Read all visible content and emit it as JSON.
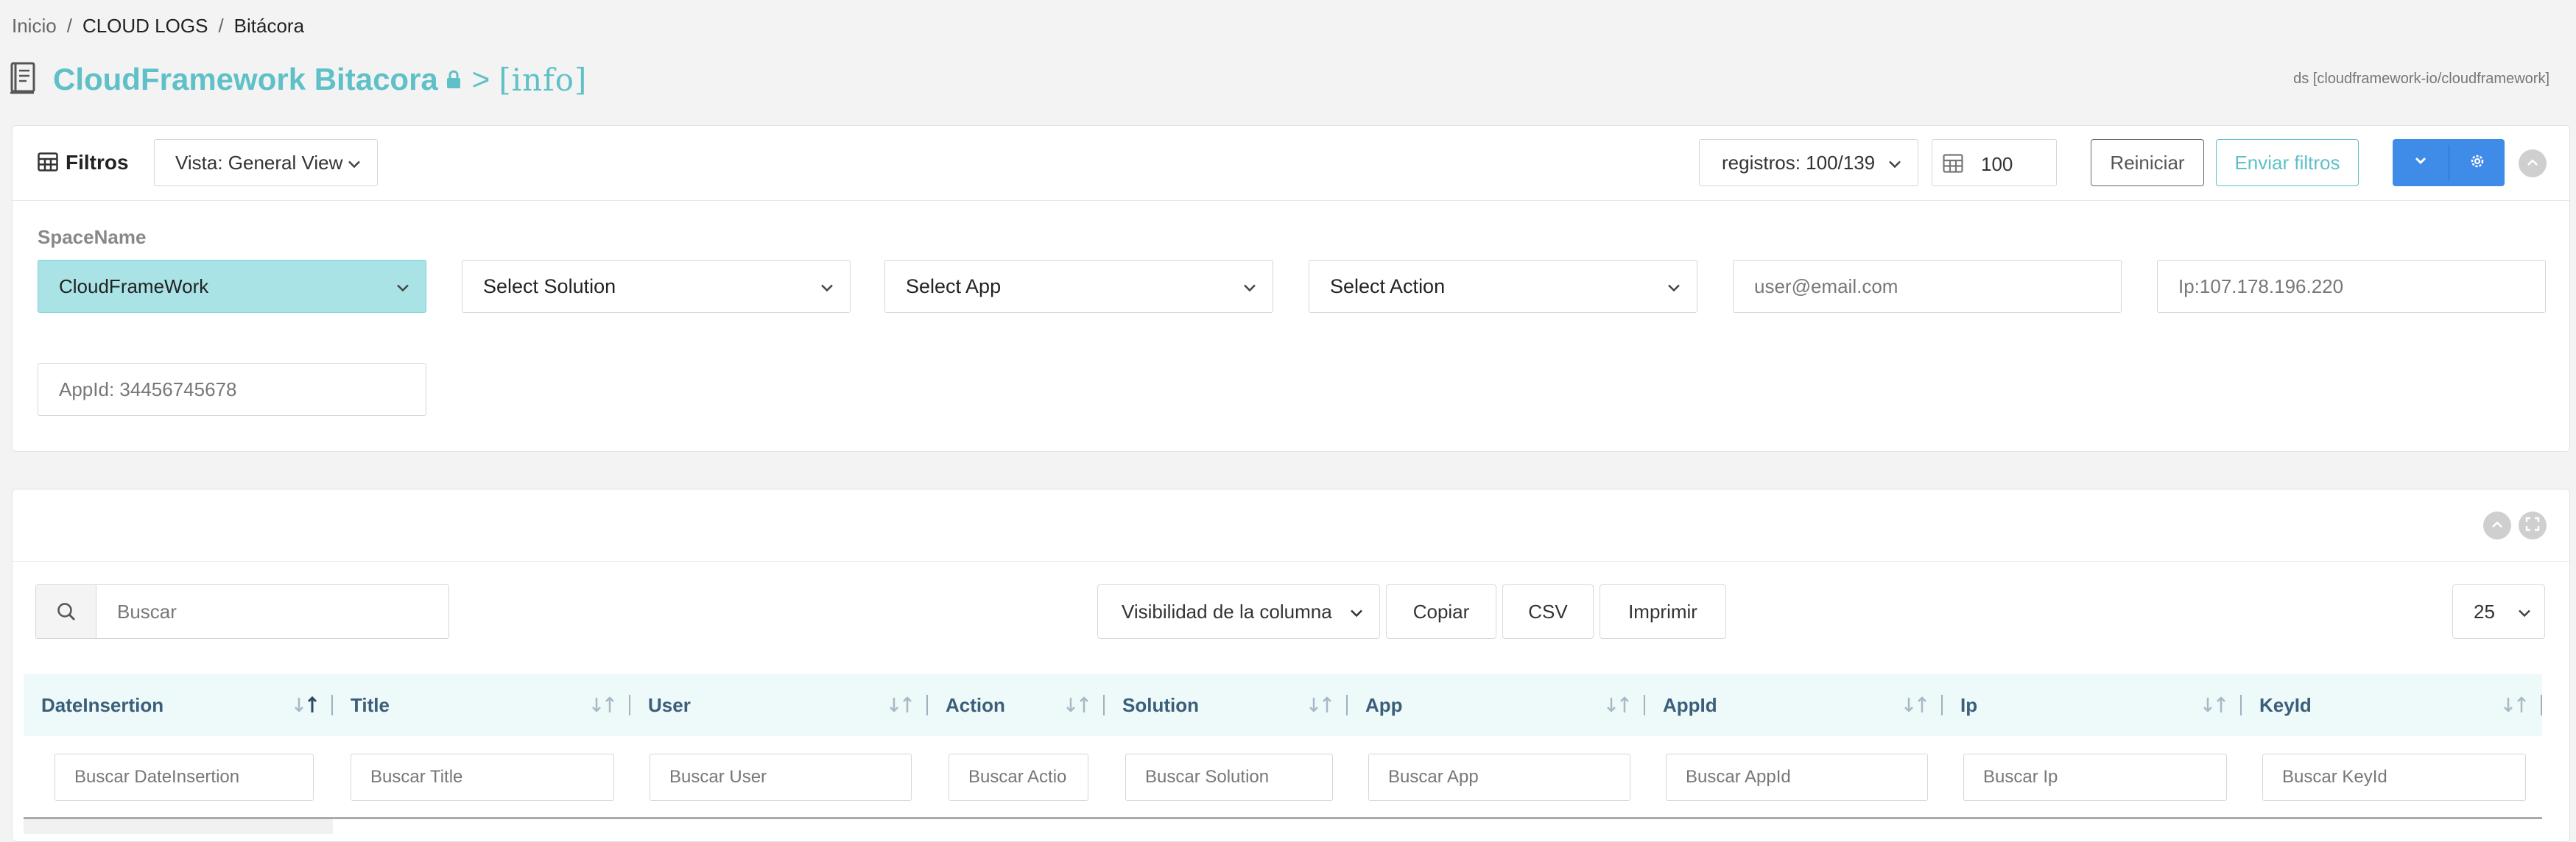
{
  "breadcrumb": {
    "items": [
      "Inicio",
      "CLOUD LOGS",
      "Bitácora"
    ]
  },
  "header": {
    "title": "CloudFramework Bitacora",
    "separator": ">",
    "info_label": "[info]",
    "datastore": "ds [cloudframework-io/cloudframework]"
  },
  "filters": {
    "title": "Filtros",
    "view_select": "Vista: General View",
    "records_select": "registros: 100/139",
    "limit_value": "100",
    "reset_button": "Reiniciar",
    "send_button": "Enviar filtros",
    "space_label": "SpaceName",
    "space_value": "CloudFrameWork",
    "solution_select": "Select Solution",
    "app_select": "Select App",
    "action_select": "Select Action",
    "email_placeholder": "user@email.com",
    "ip_placeholder": "Ip:107.178.196.220",
    "appid_placeholder": "AppId: 34456745678"
  },
  "table": {
    "search_placeholder": "Buscar",
    "toolbar": {
      "visibility": "Visibilidad de la columna",
      "copy": "Copiar",
      "csv": "CSV",
      "print": "Imprimir",
      "page_size": "25"
    },
    "columns": [
      {
        "label": "DateInsertion",
        "search_placeholder": "Buscar DateInsertion"
      },
      {
        "label": "Title",
        "search_placeholder": "Buscar Title"
      },
      {
        "label": "User",
        "search_placeholder": "Buscar User"
      },
      {
        "label": "Action",
        "search_placeholder": "Buscar Actio"
      },
      {
        "label": "Solution",
        "search_placeholder": "Buscar Solution"
      },
      {
        "label": "App",
        "search_placeholder": "Buscar App"
      },
      {
        "label": "AppId",
        "search_placeholder": "Buscar AppId"
      },
      {
        "label": "Ip",
        "search_placeholder": "Buscar Ip"
      },
      {
        "label": "KeyId",
        "search_placeholder": "Buscar KeyId"
      }
    ]
  },
  "colors": {
    "accent": "#5fc0c8",
    "primary": "#3f8be8",
    "selected_fill": "#a9e3e6",
    "header_row": "#eef9f9"
  },
  "icons": [
    "book-icon",
    "lock-icon",
    "table-icon",
    "chevron-down-icon",
    "gear-icon",
    "chevron-up-icon",
    "expand-icon",
    "search-icon",
    "sort-icon"
  ]
}
